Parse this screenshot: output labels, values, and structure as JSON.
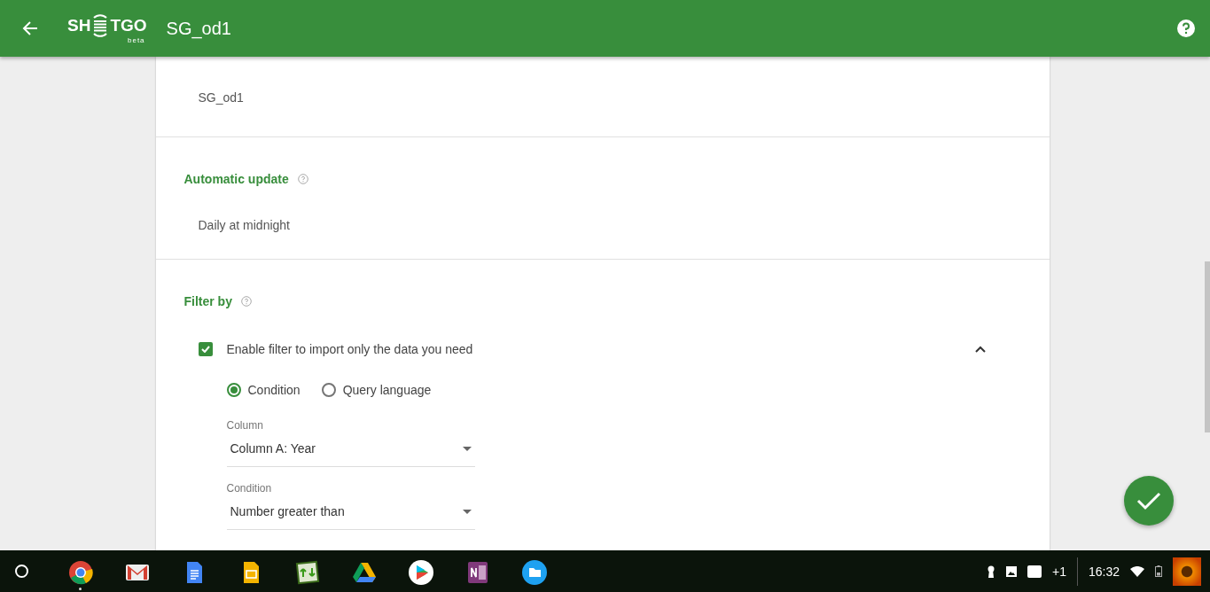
{
  "app_bar": {
    "logo": {
      "left": "SH",
      "right": "TGO",
      "sub": "beta"
    },
    "title": "SG_od1"
  },
  "sections": [
    {
      "kind": "value",
      "value": "SG_od1"
    },
    {
      "kind": "value",
      "title": "Automatic update",
      "value": "Daily at midnight"
    },
    {
      "kind": "filter",
      "title": "Filter by",
      "enable": {
        "label": "Enable filter to import only the data you need",
        "checked": true,
        "expanded": true
      },
      "modes": [
        {
          "label": "Condition",
          "selected": true
        },
        {
          "label": "Query language",
          "selected": false
        }
      ],
      "fields": [
        {
          "label": "Column",
          "value": "Column A: Year"
        },
        {
          "label": "Condition",
          "value": "Number greater than"
        }
      ]
    }
  ],
  "taskbar": {
    "apps": [
      {
        "kind": "browser",
        "active": true
      },
      {
        "kind": "mail",
        "active": false
      },
      {
        "kind": "docs",
        "active": false
      },
      {
        "kind": "slides",
        "active": false
      },
      {
        "kind": "sync",
        "active": false
      },
      {
        "kind": "drive",
        "active": false
      },
      {
        "kind": "play",
        "active": false
      },
      {
        "kind": "notes",
        "active": false
      },
      {
        "kind": "files",
        "active": false
      }
    ],
    "notification_count": "+1",
    "time": "16:32"
  }
}
